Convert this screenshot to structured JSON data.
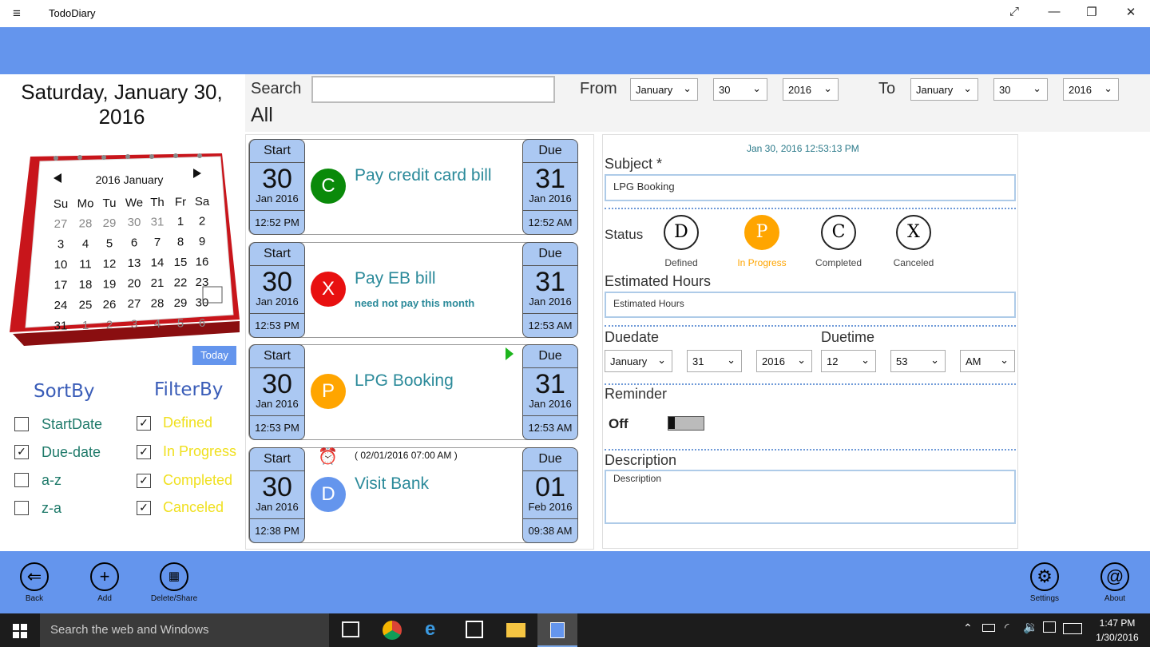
{
  "window": {
    "title": "TodoDiary",
    "menu_icon": "≡",
    "minimize": "—",
    "restore": "❐",
    "close": "✕",
    "fullscreen": "⤢"
  },
  "sidebar": {
    "date_title": "Saturday, January 30, 2016",
    "calendar": {
      "month_label": "2016 January",
      "weekdays": [
        "Su",
        "Mo",
        "Tu",
        "We",
        "Th",
        "Fr",
        "Sa"
      ],
      "rows": [
        [
          "27",
          "28",
          "29",
          "30",
          "31",
          "1",
          "2"
        ],
        [
          "3",
          "4",
          "5",
          "6",
          "7",
          "8",
          "9"
        ],
        [
          "10",
          "11",
          "12",
          "13",
          "14",
          "15",
          "16"
        ],
        [
          "17",
          "18",
          "19",
          "20",
          "21",
          "22",
          "23"
        ],
        [
          "24",
          "25",
          "26",
          "27",
          "28",
          "29",
          "30"
        ],
        [
          "31",
          "1",
          "2",
          "3",
          "4",
          "5",
          "6"
        ]
      ]
    },
    "today_label": "Today",
    "sortby_label": "SortBy",
    "filterby_label": "FilterBy",
    "sort_options": [
      {
        "label": "StartDate",
        "checked": false
      },
      {
        "label": "Due-date",
        "checked": true
      },
      {
        "label": "a-z",
        "checked": false
      },
      {
        "label": "z-a",
        "checked": false
      }
    ],
    "filter_options": [
      {
        "label": "Defined",
        "checked": true
      },
      {
        "label": "In Progress",
        "checked": true
      },
      {
        "label": "Completed",
        "checked": true
      },
      {
        "label": "Canceled",
        "checked": true
      }
    ]
  },
  "search": {
    "label": "Search",
    "value": "",
    "scope": "All",
    "from_label": "From",
    "to_label": "To",
    "from": {
      "month": "January",
      "day": "30",
      "year": "2016"
    },
    "to": {
      "month": "January",
      "day": "30",
      "year": "2016"
    }
  },
  "tasks": [
    {
      "start_hd": "Start",
      "start_day": "30",
      "start_my": "Jan 2016",
      "start_time": "12:52 PM",
      "status": "C",
      "status_color": "#0a8a0a",
      "subject": "Pay credit card bill",
      "note": "",
      "reminder": "",
      "due_hd": "Due",
      "due_day": "31",
      "due_my": "Jan 2016",
      "due_time": "12:52 AM"
    },
    {
      "start_hd": "Start",
      "start_day": "30",
      "start_my": "Jan 2016",
      "start_time": "12:53 PM",
      "status": "X",
      "status_color": "#e81010",
      "subject": "Pay EB bill",
      "note": "need not pay this month",
      "reminder": "",
      "due_hd": "Due",
      "due_day": "31",
      "due_my": "Jan 2016",
      "due_time": "12:53 AM"
    },
    {
      "start_hd": "Start",
      "start_day": "30",
      "start_my": "Jan 2016",
      "start_time": "12:53 PM",
      "status": "P",
      "status_color": "#ffa500",
      "subject": "LPG Booking",
      "note": "",
      "reminder": "",
      "due_hd": "Due",
      "due_day": "31",
      "due_my": "Jan 2016",
      "due_time": "12:53 AM"
    },
    {
      "start_hd": "Start",
      "start_day": "30",
      "start_my": "Jan 2016",
      "start_time": "12:38 PM",
      "status": "D",
      "status_color": "#6495ed",
      "subject": "Visit Bank",
      "note": "",
      "reminder": "( 02/01/2016 07:00 AM )",
      "due_hd": "Due",
      "due_day": "01",
      "due_my": "Feb 2016",
      "due_time": "09:38 AM"
    }
  ],
  "detail": {
    "timestamp": "Jan 30, 2016  12:53:13 PM",
    "subject_label": "Subject *",
    "subject_value": "LPG Booking",
    "status_label": "Status",
    "statuses": [
      {
        "letter": "D",
        "label": "Defined"
      },
      {
        "letter": "P",
        "label": "In Progress"
      },
      {
        "letter": "C",
        "label": "Completed"
      },
      {
        "letter": "X",
        "label": "Canceled"
      }
    ],
    "est_label": "Estimated Hours",
    "est_placeholder": "Estimated Hours",
    "duedate_label": "Duedate",
    "duetime_label": "Duetime",
    "due": {
      "month": "January",
      "day": "31",
      "year": "2016",
      "hour": "12",
      "minute": "53",
      "ampm": "AM"
    },
    "reminder_label": "Reminder",
    "reminder_state": "Off",
    "desc_label": "Description",
    "desc_placeholder": "Description"
  },
  "appbar": {
    "back": "Back",
    "add": "Add",
    "delete_share": "Delete/Share",
    "settings": "Settings",
    "about": "About"
  },
  "taskbar": {
    "search_placeholder": "Search the web and Windows",
    "time": "1:47 PM",
    "date": "1/30/2016"
  }
}
